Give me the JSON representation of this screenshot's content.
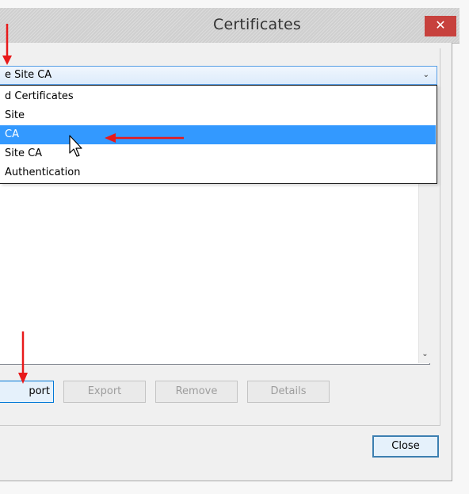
{
  "window": {
    "title": "Certificates",
    "close_glyph": "✕"
  },
  "combo": {
    "selected": "e Site CA",
    "arrow": "⌄"
  },
  "dropdown": {
    "options": [
      {
        "label": "d Certificates"
      },
      {
        "label": " Site"
      },
      {
        "label": "CA"
      },
      {
        "label": " Site CA"
      },
      {
        "label": "Authentication"
      }
    ],
    "selected_index": 2
  },
  "list": {
    "scroll_down_glyph": "⌄"
  },
  "buttons": {
    "import": "port",
    "export": "Export",
    "remove": "Remove",
    "details": "Details",
    "close": "Close"
  },
  "colors": {
    "selection": "#3399ff",
    "annotation_arrow": "#e8191a",
    "close_x_bg": "#c7413d"
  },
  "icons": [
    "close-icon",
    "chevron-down-icon",
    "mouse-pointer-icon",
    "annotation-arrow-icon"
  ]
}
